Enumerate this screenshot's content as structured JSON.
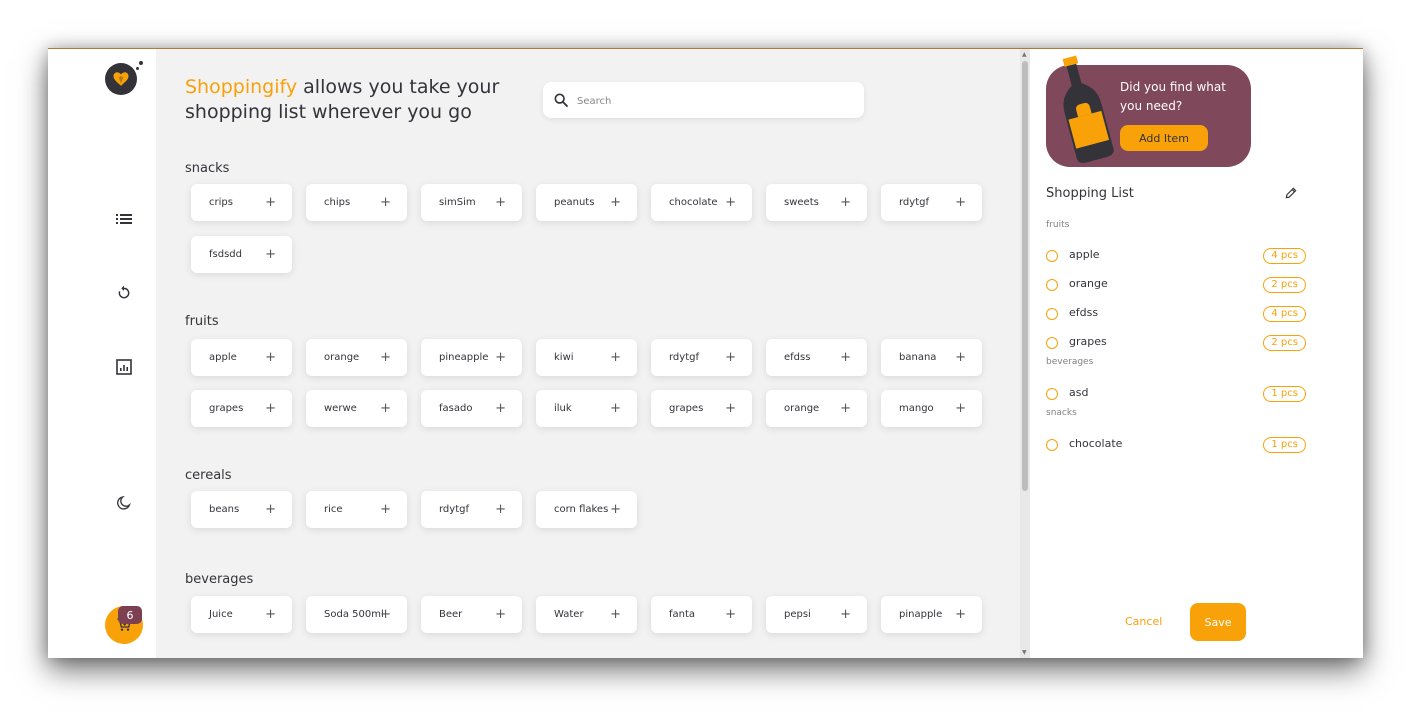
{
  "app": {
    "headline_brand": "Shoppingify",
    "headline_rest": " allows you take your shopping list wherever you go",
    "cart_count": "6"
  },
  "search": {
    "placeholder": "Search"
  },
  "categories": [
    {
      "name": "snacks",
      "items": [
        "crips",
        "chips",
        "simSim",
        "peanuts",
        "chocolate",
        "sweets",
        "rdytgf",
        "fsdsdd"
      ]
    },
    {
      "name": "fruits",
      "items": [
        "apple",
        "orange",
        "pineapple",
        "kiwi",
        "rdytgf",
        "efdss",
        "banana",
        "grapes",
        "werwe",
        "fasado",
        "iluk",
        "grapes",
        "orange",
        "mango"
      ]
    },
    {
      "name": "cereals",
      "items": [
        "beans",
        "rice",
        "rdytgf",
        "corn flakes"
      ]
    },
    {
      "name": "beverages",
      "items": [
        "Juice",
        "Soda 500ml",
        "Beer",
        "Water",
        "fanta",
        "pepsi",
        "pinapple"
      ]
    }
  ],
  "plus_glyph": "+",
  "banner": {
    "text": "Did you find what you need?",
    "button": "Add Item"
  },
  "shopping_list": {
    "title": "Shopping List",
    "groups": [
      {
        "category": "fruits",
        "items": [
          {
            "name": "apple",
            "qty": "4 pcs"
          },
          {
            "name": "orange",
            "qty": "2 pcs"
          },
          {
            "name": "efdss",
            "qty": "4 pcs"
          },
          {
            "name": "grapes",
            "qty": "2 pcs"
          }
        ]
      },
      {
        "category": "beverages",
        "items": [
          {
            "name": "asd",
            "qty": "1 pcs"
          }
        ]
      },
      {
        "category": "snacks",
        "items": [
          {
            "name": "chocolate",
            "qty": "1 pcs"
          }
        ]
      }
    ],
    "cancel": "Cancel",
    "save": "Save"
  },
  "colors": {
    "accent": "#f9a109",
    "banner": "#80485b",
    "dark": "#34333a",
    "main_bg": "#f2f2f2"
  },
  "icons": {
    "logo": "heart-logo-icon",
    "nav": [
      "list-icon",
      "refresh-icon",
      "chart-icon",
      "moon-icon"
    ],
    "cart": "cart-icon",
    "edit": "pencil-icon",
    "search": "search-icon"
  }
}
